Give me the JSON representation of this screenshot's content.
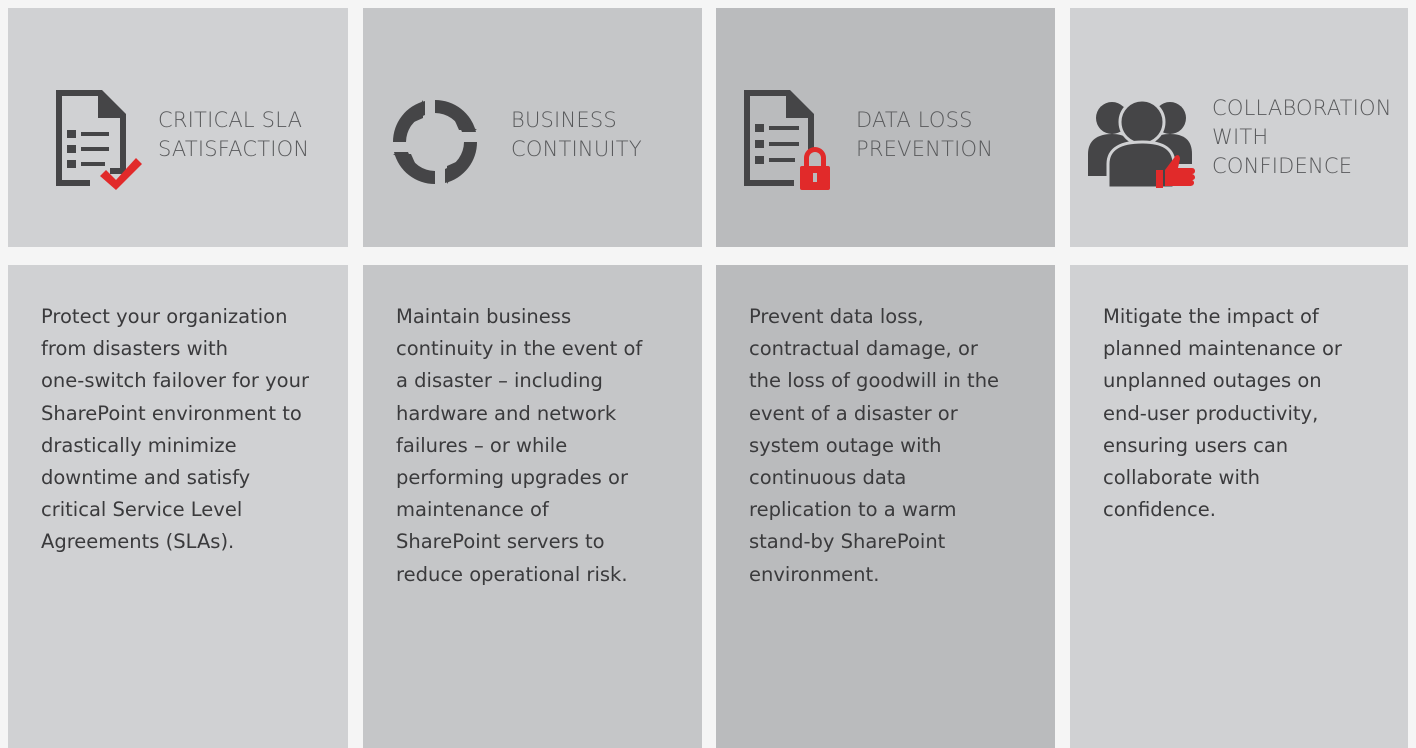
{
  "features": [
    {
      "icon": "document-checkmark-icon",
      "title_lines": [
        "CRITICAL SLA",
        "SATISFACTION"
      ],
      "description_lines": [
        "Protect your organization",
        "from disasters with",
        "one-switch failover for your",
        "SharePoint environment to",
        "drastically minimize",
        "downtime and satisfy",
        "critical Service Level",
        "Agreements (SLAs)."
      ]
    },
    {
      "icon": "circular-arrows-icon",
      "title_lines": [
        "BUSINESS",
        "CONTINUITY"
      ],
      "description_lines": [
        "Maintain business",
        "continuity in the event of",
        "a disaster – including",
        "hardware and network",
        "failures – or while",
        "performing upgrades or",
        "maintenance of",
        "SharePoint servers to",
        "reduce operational risk."
      ]
    },
    {
      "icon": "document-lock-icon",
      "title_lines": [
        "DATA LOSS",
        "PREVENTION"
      ],
      "description_lines": [
        "Prevent data loss,",
        "contractual damage, or",
        "the loss of goodwill in the",
        "event of a disaster or",
        "system outage with",
        "continuous data",
        "replication to a warm",
        "stand-by SharePoint",
        "environment."
      ]
    },
    {
      "icon": "users-thumbs-up-icon",
      "title_lines": [
        "COLLABORATION",
        "WITH",
        "CONFIDENCE"
      ],
      "description_lines": [
        "Mitigate the impact of",
        "planned maintenance or",
        "unplanned outages on",
        "end-user productivity,",
        "ensuring users can",
        "collaborate with",
        "confidence."
      ]
    }
  ],
  "colors": {
    "icon_gray": "#454547",
    "accent_red": "#e12a2a",
    "title_text": "#58595b",
    "body_text": "#3a3a3c"
  }
}
